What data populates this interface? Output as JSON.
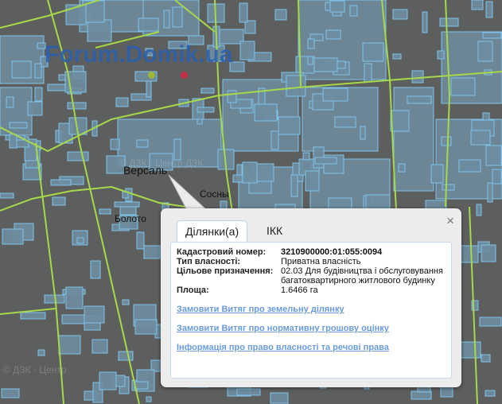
{
  "watermark": {
    "text": "Forum.Domik.ua",
    "dot_colors": [
      "#9cb63a",
      "#c8304a"
    ]
  },
  "map_labels": {
    "versal": "Версаль",
    "sosny": "Сосны",
    "boloto": "Болото"
  },
  "copyrights": [
    "© ДЗК · Центр ДЗК",
    "© ДЗК · Центр"
  ],
  "colors": {
    "background": "#5d5f5f",
    "parcel_fill": "#6e8da0",
    "parcel_stroke": "#7fc3ec",
    "road": "#a7d84a",
    "link": "#6a9bd8"
  },
  "popup": {
    "close_glyph": "×",
    "tabs": [
      {
        "label": "Ділянки(а)",
        "active": true
      },
      {
        "label": "ІКК",
        "active": false
      }
    ],
    "fields": [
      {
        "key": "Кадастровий номер:",
        "value": "3210900000:01:055:0094",
        "bold": true
      },
      {
        "key": "Тип власності:",
        "value": "Приватна власність",
        "bold": false
      },
      {
        "key": "Цільове призначення:",
        "value": "02.03 Для будівництва і обслуговування багатоквартирного житлового будинку",
        "bold": false
      },
      {
        "key": "Площа:",
        "value": "1.6466 га",
        "bold": false
      }
    ],
    "links": [
      "Замовити Витяг про земельну ділянку",
      "Замовити Витяг про нормативну грошову оцінку",
      "Інформація про право власності та речові права"
    ]
  }
}
